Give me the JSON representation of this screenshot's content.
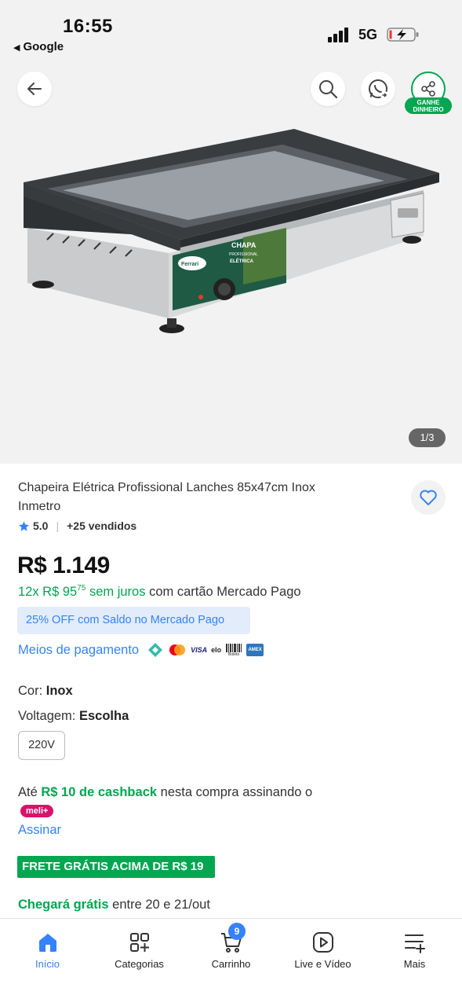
{
  "status_bar": {
    "time": "16:55",
    "back_app": "Google",
    "network": "5G"
  },
  "gallery": {
    "counter": "1/3",
    "product_labels": {
      "brand": "Ferrari",
      "panel_title": "CHAPA",
      "panel_sub1": "PROFISSIONAL",
      "panel_sub2": "ELÉTRICA"
    }
  },
  "header_actions": {
    "earn_badge_line1": "GANHE",
    "earn_badge_line2": "DINHEIRO"
  },
  "product": {
    "title": "Chapeira Elétrica Profissional Lanches 85x47cm Inox Inmetro",
    "rating": "5.0",
    "sold": "+25 vendidos",
    "price": "R$ 1.149",
    "installment_prefix": "12x R$ 95",
    "installment_cents": "75",
    "installment_interest": "sem juros",
    "installment_suffix": "com cartão Mercado Pago",
    "promo": "25% OFF com Saldo no Mercado Pago",
    "payment_link": "Meios de pagamento",
    "payment_icons": [
      "pix-icon",
      "mastercard-icon",
      "visa-icon",
      "elo-icon",
      "boleto-icon",
      "amex-icon"
    ],
    "payment_icon_labels": {
      "visa": "VISA",
      "elo": "elo",
      "boleto": "Boleto",
      "amex": "AMEX"
    }
  },
  "variations": {
    "color_label": "Cor:",
    "color_value": "Inox",
    "voltage_label": "Voltagem:",
    "voltage_value": "Escolha",
    "voltage_option": "220V"
  },
  "cashback": {
    "prefix": "Até",
    "amount": "R$ 10 de cashback",
    "middle": "nesta compra assinando o",
    "badge": "meli+",
    "subscribe": "Assinar"
  },
  "shipping": {
    "free_banner": "FRETE GRÁTIS ACIMA DE R$ 19",
    "delivery_green": "Chegará grátis",
    "delivery_rest": "entre 20 e 21/out"
  },
  "bottom_nav": {
    "items": [
      {
        "label": "Início",
        "icon": "home-icon"
      },
      {
        "label": "Categorias",
        "icon": "categories-icon"
      },
      {
        "label": "Carrinho",
        "icon": "cart-icon"
      },
      {
        "label": "Live e Vídeo",
        "icon": "play-icon"
      },
      {
        "label": "Mais",
        "icon": "menu-plus-icon"
      }
    ],
    "cart_count": "9"
  },
  "colors": {
    "accent_blue": "#3483fa",
    "green": "#00a650",
    "meli_pink": "#d8126d"
  }
}
